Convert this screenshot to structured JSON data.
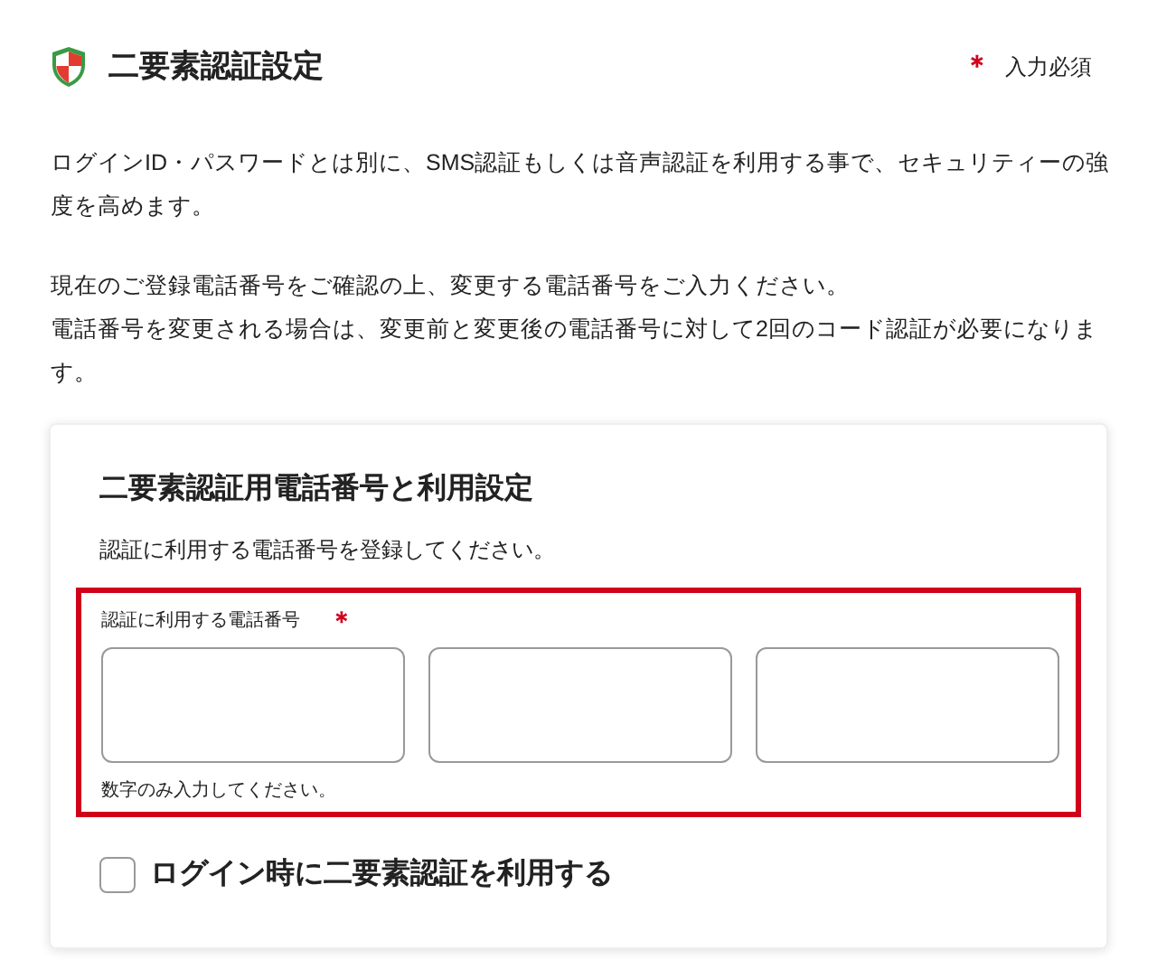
{
  "header": {
    "title": "二要素認証設定",
    "required_mark": "＊",
    "required_label": "入力必須"
  },
  "intro": [
    [
      "ログインID・パスワードとは別に、SMS認証もしくは音声認証を利用する事で、セキュリティーの強度を高めます。"
    ],
    [
      "現在のご登録電話番号をご確認の上、変更する電話番号をご入力ください。",
      "電話番号を変更される場合は、変更前と変更後の電話番号に対して2回のコード認証が必要になります。"
    ]
  ],
  "card": {
    "title": "二要素認証用電話番号と利用設定",
    "description": "認証に利用する電話番号を登録してください。",
    "phone": {
      "label": "認証に利用する電話番号",
      "required_mark": "＊",
      "error": true,
      "hint": "数字のみ入力してください。",
      "fields": [
        {
          "kind": "text"
        },
        {
          "kind": "text"
        },
        {
          "kind": "text"
        }
      ]
    },
    "checkbox": {
      "label": "ログイン時に二要素認証を利用する",
      "checked": false
    }
  }
}
